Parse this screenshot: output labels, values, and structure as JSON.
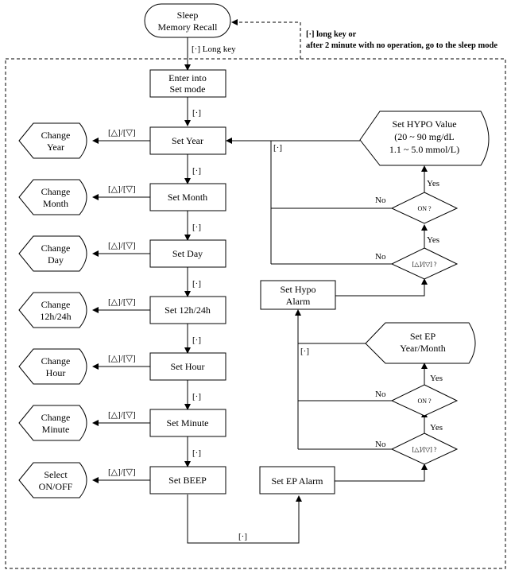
{
  "diagram": {
    "start": {
      "line1": "Sleep",
      "line2": "Memory Recall"
    },
    "long_key_label": "[·] Long key",
    "return_note": {
      "line1": "[·] long key or",
      "line2": "after 2 minute with no operation, go to the sleep mode"
    },
    "enter_set": {
      "line1": "Enter into",
      "line2": "Set mode"
    },
    "dot_key": "[·]",
    "updown_key": "[△]/[▽]",
    "main_steps": [
      {
        "label": "Set Year",
        "action_line1": "Change",
        "action_line2": "Year"
      },
      {
        "label": "Set Month",
        "action_line1": "Change",
        "action_line2": "Month"
      },
      {
        "label": "Set Day",
        "action_line1": "Change",
        "action_line2": "Day"
      },
      {
        "label": "Set 12h/24h",
        "action_line1": "Change",
        "action_line2": "12h/24h"
      },
      {
        "label": "Set Hour",
        "action_line1": "Change",
        "action_line2": "Hour"
      },
      {
        "label": "Set Minute",
        "action_line1": "Change",
        "action_line2": "Minute"
      },
      {
        "label": "Set BEEP",
        "action_line1": "Select",
        "action_line2": "ON/OFF"
      }
    ],
    "ep_alarm": "Set EP Alarm",
    "hypo_alarm": {
      "line1": "Set Hypo",
      "line2": "Alarm"
    },
    "decision_updown": "[△]/[▽] ?",
    "decision_on": "ON ?",
    "yes": "Yes",
    "no": "No",
    "set_ep": {
      "line1": "Set EP",
      "line2": "Year/Month"
    },
    "set_hypo": {
      "line1": "Set HYPO Value",
      "line2": "(20 ~ 90 mg/dL",
      "line3": "1.1 ~ 5.0 mmol/L)"
    }
  }
}
